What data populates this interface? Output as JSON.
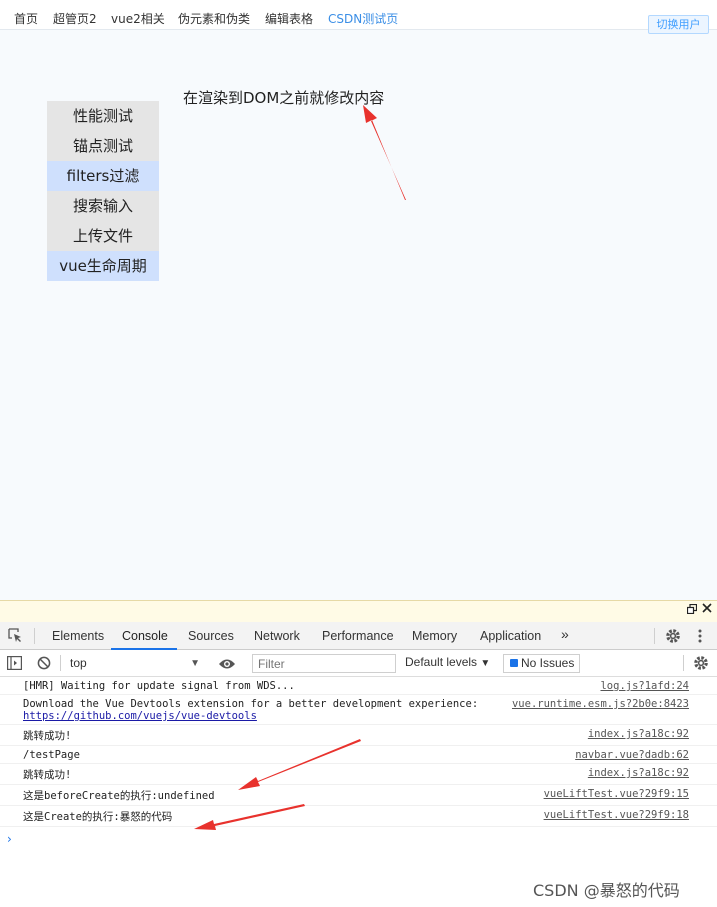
{
  "nav": {
    "items": [
      "首页",
      "超管页2",
      "vue2相关",
      "伪元素和伪类",
      "编辑表格",
      "CSDN测试页"
    ],
    "switch_user": "切换用户"
  },
  "content": {
    "headline": "在渲染到DOM之前就修改内容",
    "menu": [
      "性能测试",
      "锚点测试",
      "filters过滤",
      "搜索输入",
      "上传文件",
      "vue生命周期"
    ]
  },
  "devtools": {
    "tabs": [
      "Elements",
      "Console",
      "Sources",
      "Network",
      "Performance",
      "Memory",
      "Application"
    ],
    "more": "»",
    "context": "top",
    "filter_placeholder": "Filter",
    "levels": "Default levels",
    "issues": "No Issues",
    "logs": [
      {
        "msg": "[HMR] Waiting for update signal from WDS...",
        "src": "log.js?1afd:24"
      },
      {
        "msg": "Download the Vue Devtools extension for a better development experience:",
        "msg2": "https://github.com/vuejs/vue-devtools",
        "src": "vue.runtime.esm.js?2b0e:8423"
      },
      {
        "msg": "跳转成功!",
        "src": "index.js?a18c:92"
      },
      {
        "msg": "/testPage",
        "src": "navbar.vue?dadb:62"
      },
      {
        "msg": "跳转成功!",
        "src": "index.js?a18c:92"
      },
      {
        "msg": "这是beforeCreate的执行:undefined",
        "src": "vueLiftTest.vue?29f9:15"
      },
      {
        "msg": "这是Create的执行:暴怒的代码",
        "src": "vueLiftTest.vue?29f9:18"
      }
    ],
    "prompt": "›"
  },
  "watermark": "CSDN @暴怒的代码",
  "colors": {
    "accent": "#1a73e8",
    "arrow": "#e8322d",
    "menu_highlight": "#cfe0fd"
  }
}
